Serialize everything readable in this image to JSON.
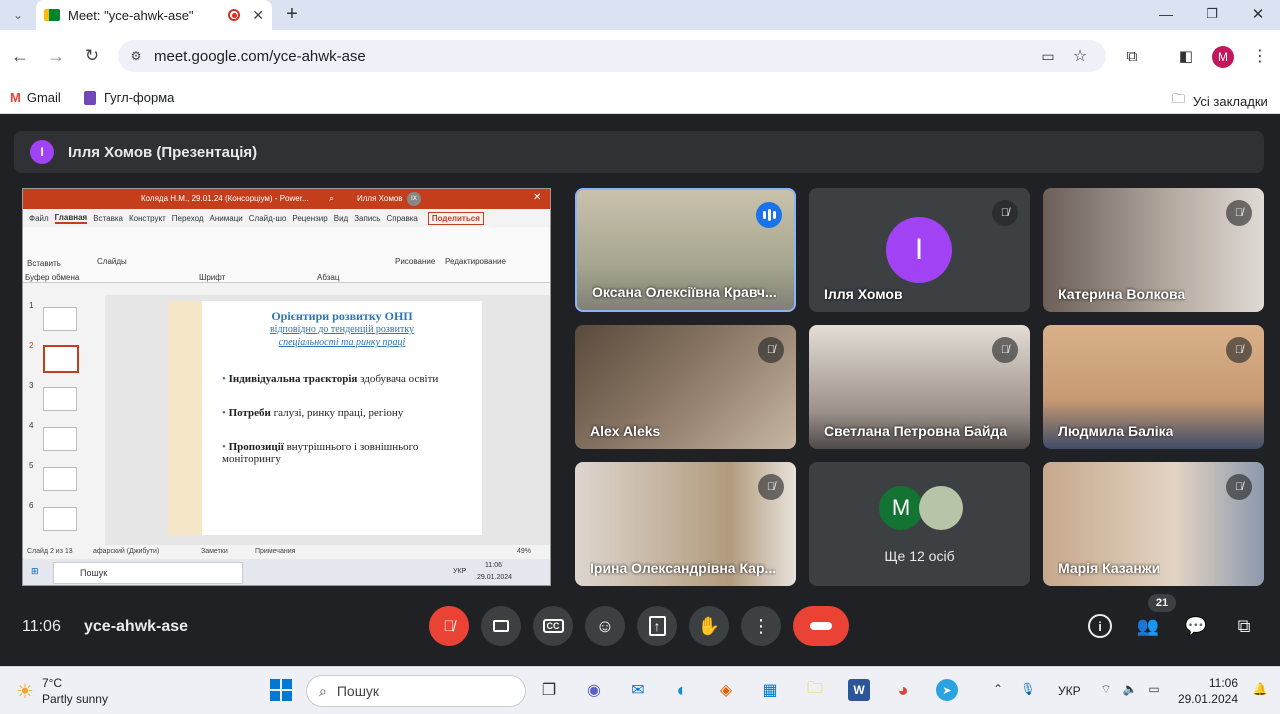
{
  "browser": {
    "tab_title": "Meet: \"yce-ahwk-ase\"",
    "url": "meet.google.com/yce-ahwk-ase",
    "profile_initial": "M",
    "bookmarks": [
      {
        "label": "Gmail"
      },
      {
        "label": "Гугл-форма"
      }
    ],
    "all_bookmarks": "Усі закладки"
  },
  "presentation": {
    "presenter_initial": "I",
    "title": "Ілля Хомов (Презентація)"
  },
  "ppt": {
    "title": "Коляда Н.М., 29.01.24 (Консорціум) - Power...",
    "user": "Илля Хомов",
    "user_badge": "IX",
    "tabs": [
      "Файл",
      "Главная",
      "Вставка",
      "Конструкт",
      "Переход",
      "Анимаци",
      "Слайд-шо",
      "Рецензир",
      "Вид",
      "Запись",
      "Справка"
    ],
    "share": "Поделиться",
    "groups": [
      "Буфер обмена",
      "Шрифт",
      "Абзац"
    ],
    "ribbon": {
      "paste": "Вставить",
      "slides": "Слайды",
      "draw": "Рисование",
      "edit": "Редактирование"
    },
    "thumbs": [
      "1",
      "2",
      "3",
      "4",
      "5",
      "6"
    ],
    "slide": {
      "title": "Орієнтири розвитку ОНП",
      "sub1": "відповідно до тенденцій розвитку",
      "sub2": "спеціальності та ринку праці",
      "b1_bold": "Індивідуальна траєкторія",
      "b1_rest": " здобувача освіти",
      "b2_bold": "Потреби",
      "b2_rest": " галузі, ринку праці, регіону",
      "b3_bold": "Пропозиції",
      "b3_rest": " внутрішнього і зовнішнього моніторингу"
    },
    "status": {
      "slide": "Слайд 2 из 13",
      "lang": "афарский (Джибути)",
      "notes": "Заметки",
      "comments": "Примечания",
      "zoom": "49%"
    },
    "win_taskbar": {
      "search": "Пошук",
      "lang": "УКР",
      "time": "11:06",
      "date": "29.01.2024"
    }
  },
  "tiles": [
    {
      "name": "Оксана Олексіївна Кравч...",
      "speaking": true
    },
    {
      "name": "Ілля Хомов",
      "initial": "I"
    },
    {
      "name": "Катерина Волкова"
    },
    {
      "name": "Alex Aleks"
    },
    {
      "name": "Светлана Петровна Байда"
    },
    {
      "name": "Людмила Баліка"
    },
    {
      "name": "Ірина Олександрівна Кар..."
    },
    {
      "name": "Ще 12 осіб",
      "initial": "M"
    },
    {
      "name": "Марія Казанжи"
    }
  ],
  "controls": {
    "time": "11:06",
    "meeting_code": "yce-ahwk-ase",
    "participants_count": "21"
  },
  "taskbar": {
    "weather_temp": "7°C",
    "weather_desc": "Partly sunny",
    "search": "Пошук",
    "lang": "УКР",
    "time": "11:06",
    "date": "29.01.2024"
  },
  "colors": {
    "meet_bg": "#202124",
    "hangup": "#ea4335",
    "avatar_purple": "#a142f4",
    "avatar_green": "#137333",
    "ppt_red": "#c43e1c"
  }
}
